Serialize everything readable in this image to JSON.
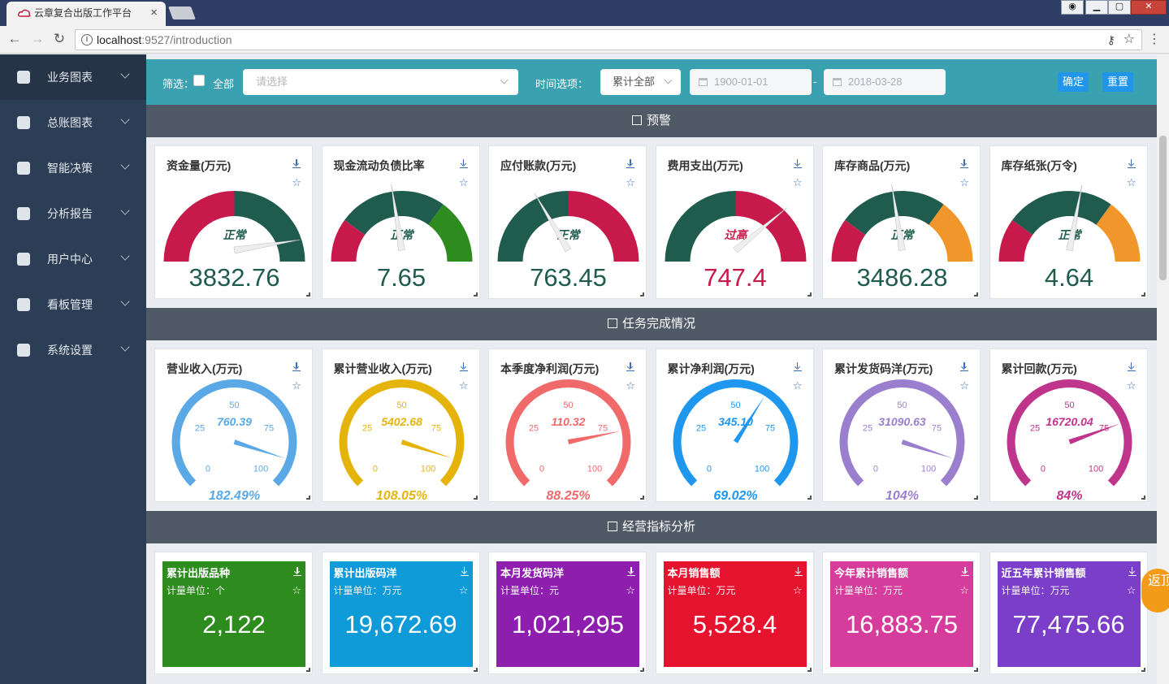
{
  "browser": {
    "tab_title": "云章复合出版工作平台",
    "tab_close": "×",
    "url_host": "localhost",
    "url_path": ":9527/introduction"
  },
  "sidebar": {
    "items": [
      {
        "label": "业务图表",
        "icon": "line-chart-icon"
      },
      {
        "label": "总账图表",
        "icon": "u8-icon"
      },
      {
        "label": "智能决策",
        "icon": "brain-icon"
      },
      {
        "label": "分析报告",
        "icon": "report-icon"
      },
      {
        "label": "用户中心",
        "icon": "user-icon"
      },
      {
        "label": "看板管理",
        "icon": "dashboard-icon"
      },
      {
        "label": "系统设置",
        "icon": "gear-icon"
      }
    ]
  },
  "filter": {
    "label": "筛选：",
    "all_label": "全部",
    "select_placeholder": "请选择",
    "time_label": "时间选项：",
    "time_value": "累计全部",
    "date_start": "1900-01-01",
    "date_end": "2018-03-28",
    "dash": "-",
    "confirm": "确定",
    "reset": "重置"
  },
  "sections": {
    "warning": "预警",
    "tasks": "任务完成情况",
    "indicators": "经营指标分析"
  },
  "warning_cards": [
    {
      "title": "资金量(万元)",
      "value": "3832.76",
      "status": "正常",
      "needle_fraction": 0.95,
      "colors": [
        "#c8194b",
        "#1f5c4e"
      ],
      "split": [
        0.5
      ],
      "value_color": "#1f5c4e",
      "status_color": "#1f5c4e"
    },
    {
      "title": "现金流动负债比率",
      "value": "7.65",
      "status": "正常",
      "needle_fraction": 0.45,
      "colors": [
        "#c8194b",
        "#1f5c4e",
        "#2e8b1e"
      ],
      "split": [
        0.2,
        0.7
      ],
      "value_color": "#1f5c4e",
      "status_color": "#1f5c4e"
    },
    {
      "title": "应付账款(万元)",
      "value": "763.45",
      "status": "正常",
      "needle_fraction": 0.33,
      "colors": [
        "#1f5c4e",
        "#c8194b"
      ],
      "split": [
        0.5
      ],
      "value_color": "#1f5c4e",
      "status_color": "#1f5c4e"
    },
    {
      "title": "费用支出(万元)",
      "value": "747.4",
      "status": "过高",
      "needle_fraction": 0.78,
      "colors": [
        "#1f5c4e",
        "#c8194b"
      ],
      "split": [
        0.5
      ],
      "value_color": "#c8194b",
      "status_color": "#c8194b"
    },
    {
      "title": "库存商品(万元)",
      "value": "3486.28",
      "status": "正常",
      "needle_fraction": 0.45,
      "colors": [
        "#c8194b",
        "#1f5c4e",
        "#f0962a"
      ],
      "split": [
        0.2,
        0.7
      ],
      "value_color": "#1f5c4e",
      "status_color": "#1f5c4e"
    },
    {
      "title": "库存纸张(万令)",
      "value": "4.64",
      "status": "正常",
      "needle_fraction": 0.56,
      "colors": [
        "#c8194b",
        "#1f5c4e",
        "#f0962a"
      ],
      "split": [
        0.2,
        0.7
      ],
      "value_color": "#1f5c4e",
      "status_color": "#1f5c4e"
    }
  ],
  "task_cards": [
    {
      "title": "营业收入(万元)",
      "value": "760.39",
      "percent": "182.49%",
      "needle_fraction": 0.9,
      "color": "#5aa9e6"
    },
    {
      "title": "累计营业收入(万元)",
      "value": "5402.68",
      "percent": "108.05%",
      "needle_fraction": 0.9,
      "color": "#e5b40a"
    },
    {
      "title": "本季度净利润(万元)",
      "value": "110.32",
      "percent": "88.25%",
      "needle_fraction": 0.79,
      "color": "#f06a6a"
    },
    {
      "title": "累计净利润(万元)",
      "value": "345.10",
      "percent": "69.02%",
      "needle_fraction": 0.62,
      "color": "#1f97ef"
    },
    {
      "title": "累计发货码洋(万元)",
      "value": "31090.63",
      "percent": "104%",
      "needle_fraction": 0.9,
      "color": "#9b7fcf"
    },
    {
      "title": "累计回款(万元)",
      "value": "16720.04",
      "percent": "84%",
      "needle_fraction": 0.76,
      "color": "#c0358c"
    }
  ],
  "gauge_ticks": [
    "0",
    "25",
    "50",
    "75",
    "100"
  ],
  "kpi_cards": [
    {
      "title": "累计出版品种",
      "unit": "计量单位：个",
      "value": "2,122",
      "color": "#2e8b1e"
    },
    {
      "title": "累计出版码洋",
      "unit": "计量单位：万元",
      "value": "19,672.69",
      "color": "#0f9ad8"
    },
    {
      "title": "本月发货码洋",
      "unit": "计量单位：元",
      "value": "1,021,295",
      "color": "#8e1fae"
    },
    {
      "title": "本月销售额",
      "unit": "计量单位：万元",
      "value": "5,528.4",
      "color": "#e5132e"
    },
    {
      "title": "今年累计销售额",
      "unit": "计量单位：万元",
      "value": "16,883.75",
      "color": "#d63c9b"
    },
    {
      "title": "近五年累计销售额",
      "unit": "计量单位：万元",
      "value": "77,475.66",
      "color": "#7a3ec8"
    }
  ],
  "back_top": "返顶"
}
